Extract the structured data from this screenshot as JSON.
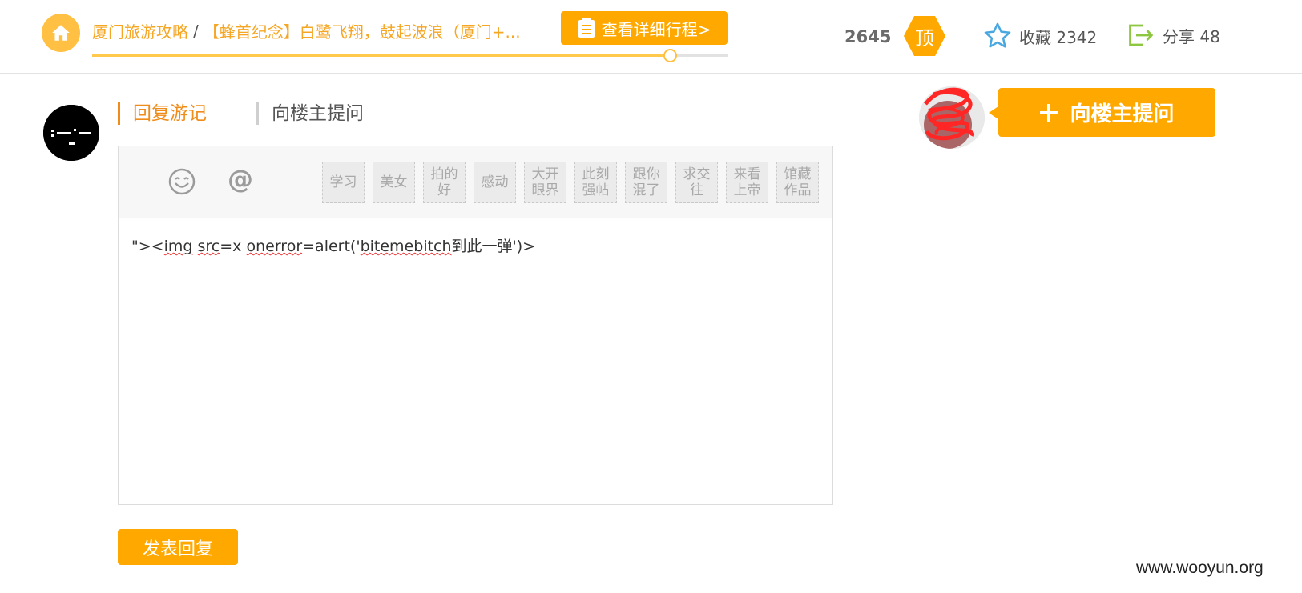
{
  "header": {
    "breadcrumb_link": "厦门旅游攻略",
    "breadcrumb_sep": "/",
    "breadcrumb_title": "【蜂首纪念】白鹭飞翔，鼓起波浪（厦门+...",
    "itinerary_button": "查看详细行程>",
    "reading_progress": 0.91,
    "top_count": "2645",
    "top_badge": "顶",
    "favorite_label": "收藏 2342",
    "share_label": "分享 48"
  },
  "tabs": [
    {
      "label": "回复游记",
      "active": true
    },
    {
      "label": "向楼主提问",
      "active": false
    }
  ],
  "toolbar": {
    "emoji_icon": "smiley-icon",
    "at_label": "@",
    "tags": [
      "学习",
      "美女",
      "拍的好",
      "感动",
      "大开眼界",
      "此刻强帖",
      "跟你混了",
      "求交往",
      "来看上帝",
      "馆藏作品"
    ]
  },
  "editor": {
    "text_prefix": "\"><",
    "word_img": "img",
    "word_src": "src",
    "text_mid1": "=x ",
    "word_onerror": "onerror",
    "text_mid2": "=alert('",
    "word_bitemebitch": "bitemebitch",
    "text_suffix": "到此一弹')>"
  },
  "submit_button": "发表回复",
  "ask_host_button": "向楼主提问",
  "watermark": "www.wooyun.org",
  "colors": {
    "accent": "#ffa800",
    "accent_text": "#f08c1a",
    "link": "#f5a623",
    "star": "#4aa8e0",
    "share": "#8dc63f"
  }
}
